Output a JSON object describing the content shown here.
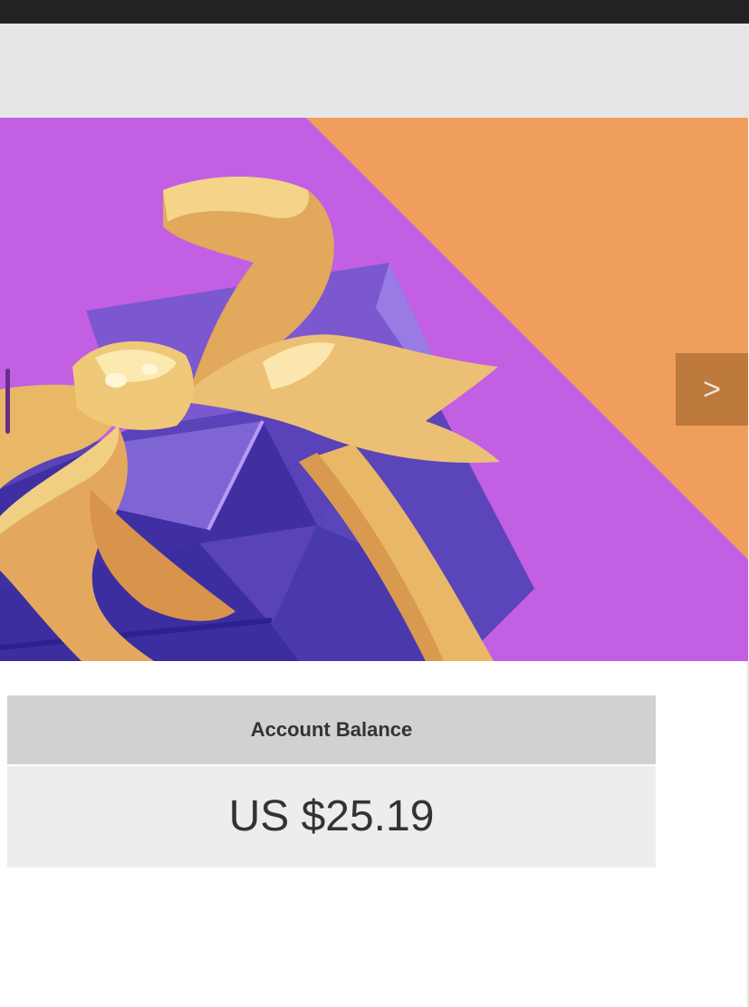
{
  "carousel": {
    "next_label": ">"
  },
  "balance": {
    "title": "Account Balance",
    "amount": "US $25.19"
  },
  "colors": {
    "top_bar": "#222222",
    "header_band": "#e6e6e6",
    "banner_purple": "#c35fe3",
    "banner_orange": "#ef9f5b",
    "gift_box": "#5a42b8",
    "ribbon": "#e8b866",
    "next_button": "#b06e34"
  },
  "icons": {
    "banner_art": "gift-box-with-ribbon-illustration"
  }
}
